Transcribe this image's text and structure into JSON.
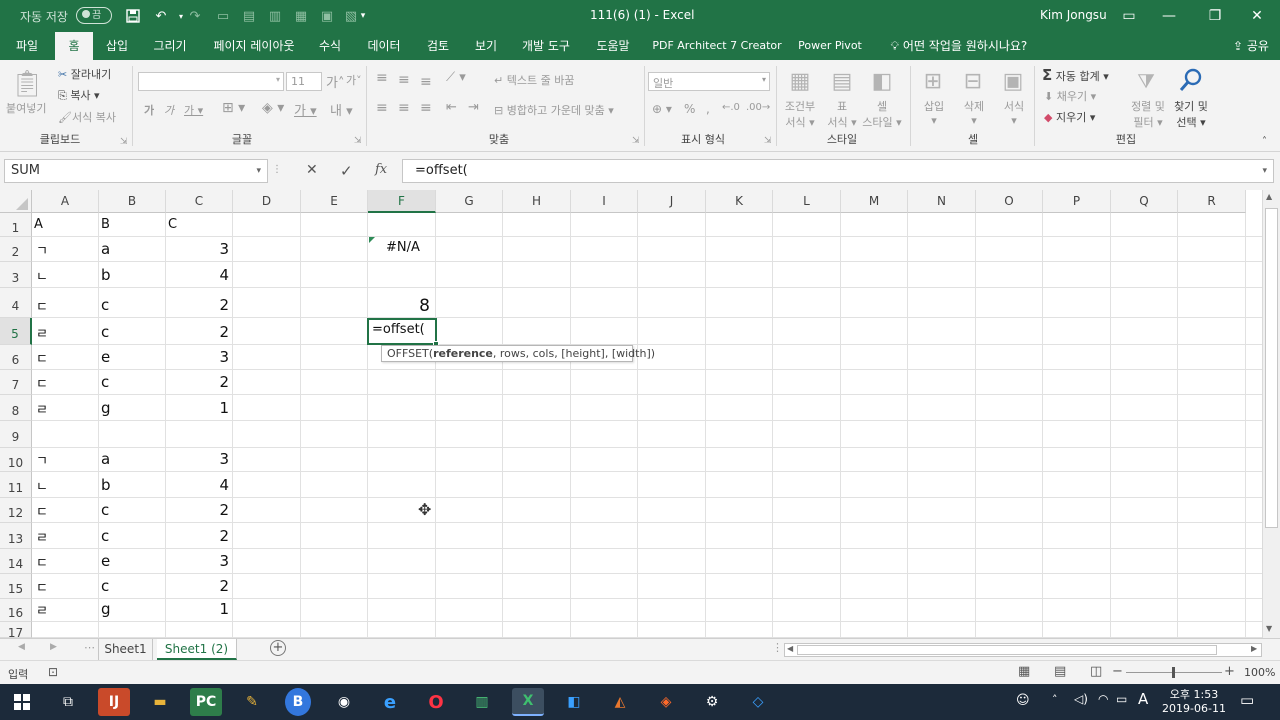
{
  "window": {
    "autosave": "자동 저장",
    "autosave_state": "끔",
    "title": "111(6) (1)  -  Excel",
    "user": "Kim Jongsu"
  },
  "tabs": [
    "파일",
    "홈",
    "삽입",
    "그리기",
    "페이지 레이아웃",
    "수식",
    "데이터",
    "검토",
    "보기",
    "개발 도구",
    "도움말",
    "PDF Architect 7 Creator",
    "Power Pivot"
  ],
  "tell_me": "어떤 작업을 원하시나요?",
  "share": "공유",
  "ribbon": {
    "clipboard": {
      "paste": "붙여넣기",
      "cut": "잘라내기",
      "copy": "복사",
      "format_painter": "서식 복사",
      "group": "클립보드"
    },
    "font": {
      "size": "11",
      "group": "글꼴"
    },
    "alignment": {
      "wrap": "텍스트 줄 바꿈",
      "merge": "병합하고 가운데 맞춤",
      "group": "맞춤"
    },
    "number": {
      "format": "일반",
      "group": "표시 형식"
    },
    "styles": {
      "conditional": "조건부",
      "conditional2": "서식",
      "table": "표",
      "table2": "서식",
      "cell": "셀",
      "cell2": "스타일",
      "group": "스타일"
    },
    "cells": {
      "insert": "삽입",
      "delete": "삭제",
      "format": "서식",
      "group": "셀"
    },
    "editing": {
      "autosum": "자동 합계",
      "fill": "채우기",
      "clear": "지우기",
      "sort": "정렬 및",
      "sort2": "필터",
      "find": "찾기 및",
      "find2": "선택",
      "group": "편집"
    }
  },
  "formula_bar": {
    "name_box": "SUM",
    "cancel": "✕",
    "enter": "✓",
    "fx": "fx",
    "formula": "=offset("
  },
  "columns": [
    "A",
    "B",
    "C",
    "D",
    "E",
    "F",
    "G",
    "H",
    "I",
    "J",
    "K",
    "L",
    "M",
    "N",
    "O",
    "P",
    "Q",
    "R"
  ],
  "rows": [
    "1",
    "2",
    "3",
    "4",
    "5",
    "6",
    "7",
    "8",
    "9",
    "10",
    "11",
    "12",
    "13",
    "14",
    "15",
    "16",
    "17"
  ],
  "cells": {
    "A1": "A",
    "B1": "B",
    "C1": "C",
    "A2": "ㄱ",
    "B2": "a",
    "C2": "3",
    "A3": "ㄴ",
    "B3": "b",
    "C3": "4",
    "A4": "ㄷ",
    "B4": "c",
    "C4": "2",
    "A5": "ㄹ",
    "B5": "c",
    "C5": "2",
    "A6": "ㄷ",
    "B6": "e",
    "C6": "3",
    "A7": "ㄷ",
    "B7": "c",
    "C7": "2",
    "A8": "ㄹ",
    "B8": "g",
    "C8": "1",
    "A10": "ㄱ",
    "B10": "a",
    "C10": "3",
    "A11": "ㄴ",
    "B11": "b",
    "C11": "4",
    "A12": "ㄷ",
    "B12": "c",
    "C12": "2",
    "A13": "ㄹ",
    "B13": "c",
    "C13": "2",
    "A14": "ㄷ",
    "B14": "e",
    "C14": "3",
    "A15": "ㄷ",
    "B15": "c",
    "C15": "2",
    "A16": "ㄹ",
    "B16": "g",
    "C16": "1",
    "F2": "#N/A",
    "F4": "8",
    "F5": "=offset("
  },
  "tooltip": {
    "fn": "OFFSET(",
    "arg1": "reference",
    "rest": ", rows, cols, [height], [width])"
  },
  "sheets": [
    "Sheet1",
    "Sheet1 (2)"
  ],
  "status": {
    "mode": "입력",
    "zoom": "100%"
  },
  "clock": {
    "time": "오후 1:53",
    "date": "2019-06-11"
  },
  "colors": {
    "accent": "#217346",
    "taskbar": "#1c2a3a"
  }
}
